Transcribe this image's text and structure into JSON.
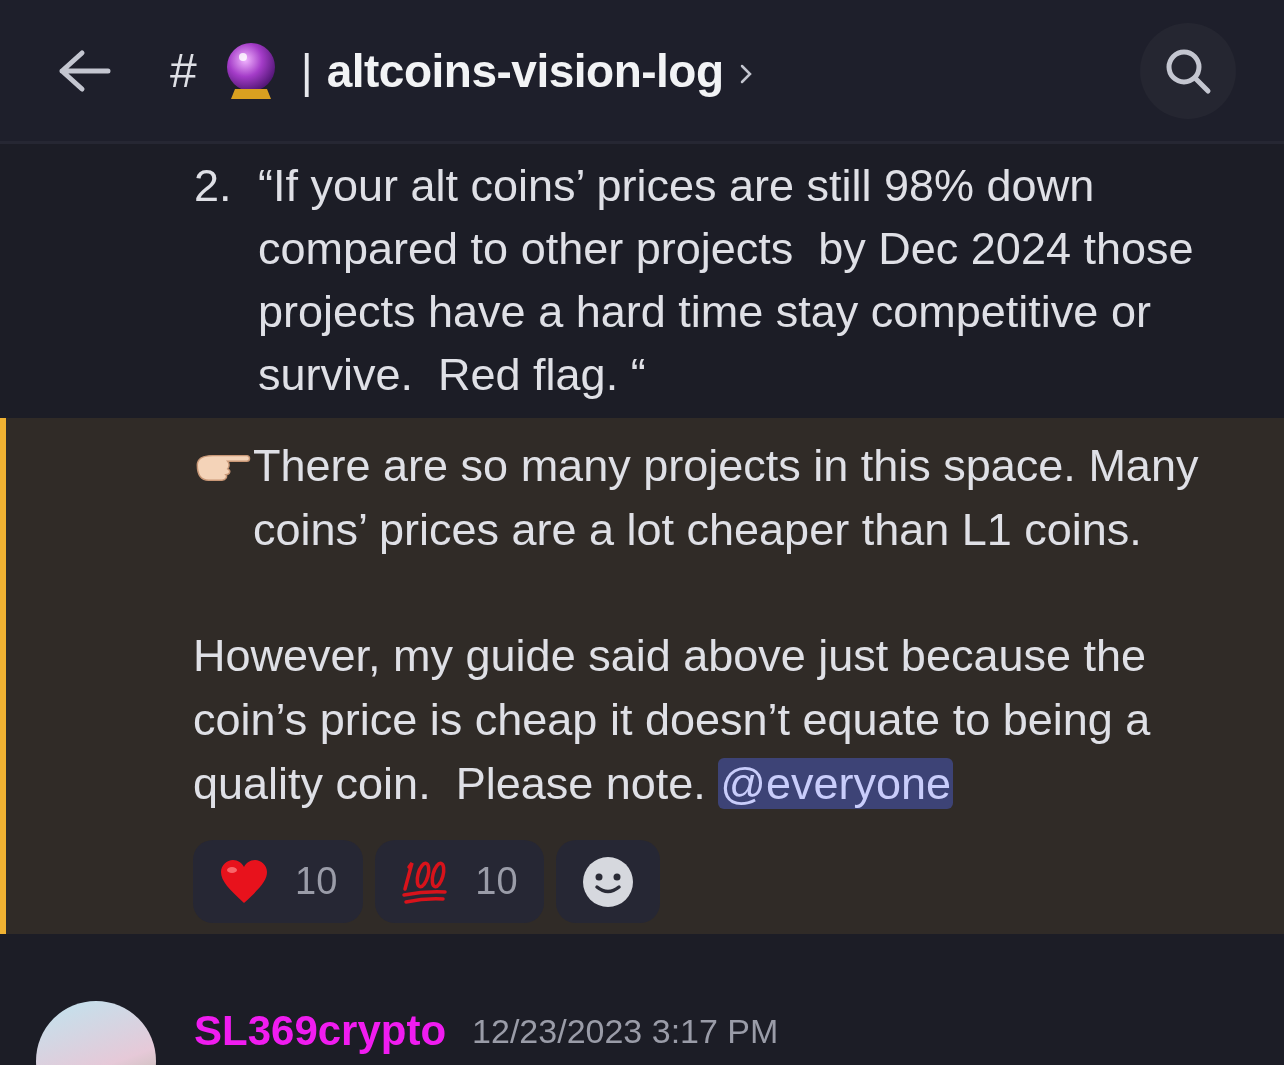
{
  "header": {
    "prefix": "#",
    "separator": "|",
    "channel_name": "altcoins-vision-log"
  },
  "earlier_message": {
    "list_items": [
      {
        "number": "2.",
        "text": "“If your alt coins’ prices are still 98% down compared to other projects  by Dec 2024 those projects have a hard time stay competitive or survive.  Red flag. “"
      }
    ]
  },
  "highlighted_message": {
    "highlighted": true,
    "paragraphs": [
      "There are so many projects in this space. Many coins’ prices are a lot cheaper than L1 coins.",
      "However, my guide said above just because the coin’s price is cheap it doesn’t equate to being a quality coin.  Please note. "
    ],
    "mention": "@everyone",
    "reactions": [
      {
        "kind": "heart",
        "count": "10"
      },
      {
        "kind": "hundred",
        "count": "10"
      }
    ]
  },
  "next_message": {
    "author": "SL369crypto",
    "timestamp": "12/23/2023 3:17 PM"
  }
}
